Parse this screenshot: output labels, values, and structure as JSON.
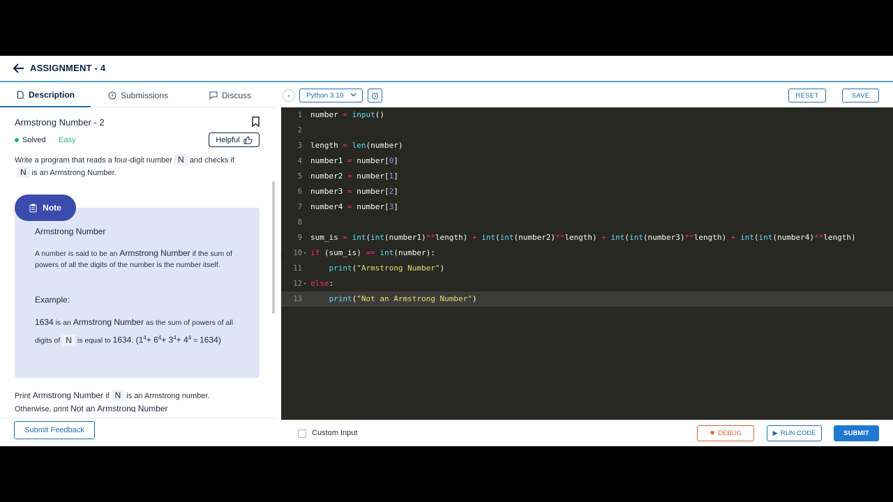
{
  "header": {
    "title": "ASSIGNMENT - 4"
  },
  "tabs": [
    {
      "label": "Description",
      "icon": "document-icon"
    },
    {
      "label": "Submissions",
      "icon": "clock-icon"
    },
    {
      "label": "Discuss",
      "icon": "chat-icon"
    }
  ],
  "problem": {
    "title": "Armstrong Number - 2",
    "status": "Solved",
    "difficulty": "Easy",
    "helpful_label": "Helpful",
    "intro_a": "Write a program that reads a four-digit number",
    "intro_var": "N",
    "intro_b": "and checks if",
    "intro_var2": "N",
    "intro_c": "is an Armstrong Number.",
    "note_label": "Note",
    "note_heading": "Armstrong Number",
    "note_p1_a": "A number is said to be an",
    "note_p1_b": "Armstrong Number",
    "note_p1_c": "if the sum of powers of all the digits of the number is the number itself.",
    "example_heading": "Example:",
    "ex_num": "1634",
    "ex_a": "is an",
    "ex_b": "Armstrong Number",
    "ex_c": "as the sum of powers of all digits of",
    "ex_var": "N",
    "ex_d": "is equal to",
    "ex_val": "1634.",
    "ex_expr_1": "(1",
    "ex_expr_2": "+ 6",
    "ex_expr_3": "+ 3",
    "ex_expr_4": "+ 4",
    "ex_expr_5": "=",
    "ex_pow": "4",
    "ex_result": "1634)",
    "print_a": "Print",
    "print_b": "Armstrong Number",
    "print_c": "if",
    "print_var": "N",
    "print_d": "is an Armstrong number.",
    "print_e": "Otherwise, print",
    "print_f": "Not an Armstrong Number"
  },
  "footer": {
    "feedback_label": "Submit Feedback"
  },
  "toolbar": {
    "language": "Python 3.10",
    "reset_label": "RESET",
    "save_label": "SAVE"
  },
  "editor": {
    "active_line": 13,
    "lines": [
      "number = input()",
      "",
      "length = len(number)",
      "number1 = number[0]",
      "number2 = number[1]",
      "number3 = number[2]",
      "number4 = number[3]",
      "",
      "sum_is = int(int(number1)**length) + int(int(number2)**length) + int(int(number3)**length) + int(int(number4)**length)",
      "if (sum_is) == int(number):",
      "    print(\"Armstrong Number\")",
      "else:",
      "    print(\"Not an Armstrong Number\")"
    ]
  },
  "bottom": {
    "custom_input_label": "Custom Input",
    "debug_label": "DEBUG",
    "run_label": "RUN CODE",
    "submit_label": "SUBMIT"
  },
  "colors": {
    "accent": "#1f78d1",
    "note_bg": "#dfe5f5",
    "note_badge": "#3b4bad",
    "editor_bg": "#272822",
    "debug": "#e2622b"
  }
}
